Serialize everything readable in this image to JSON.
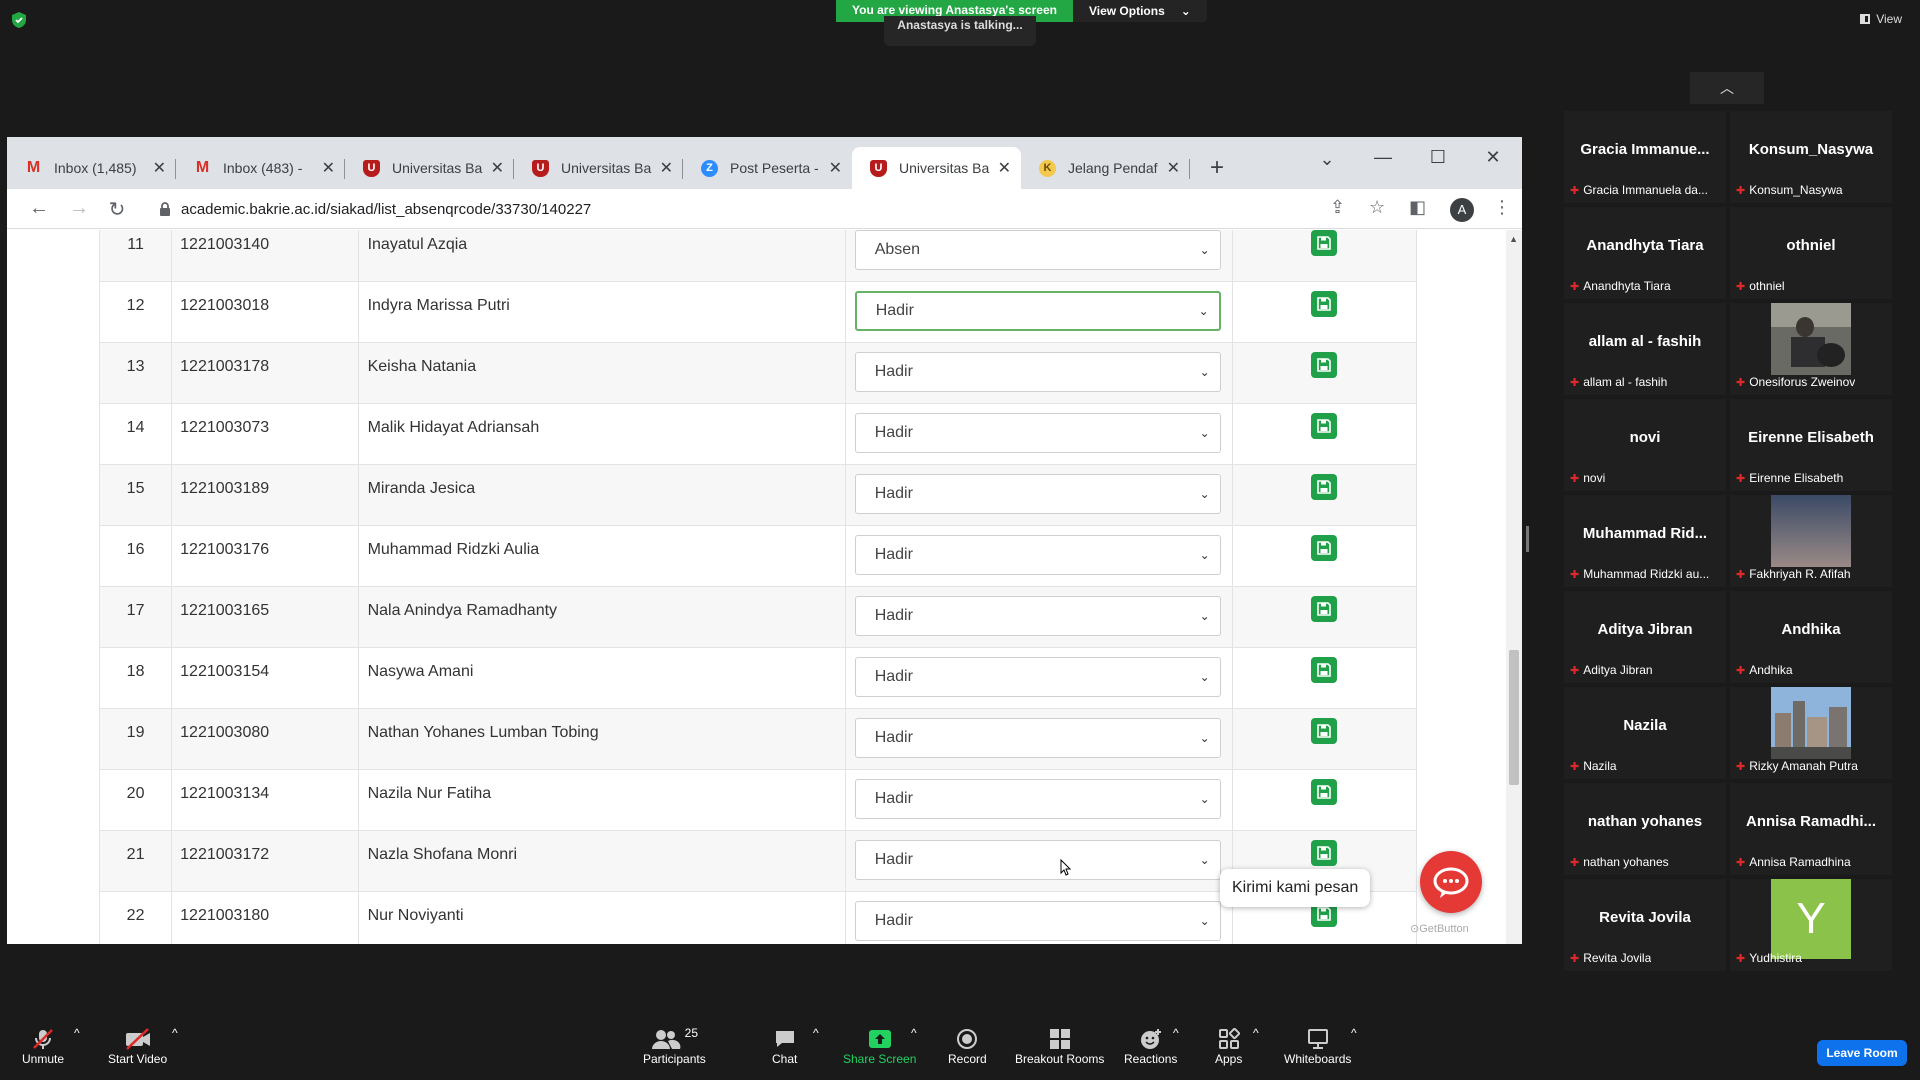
{
  "zoom": {
    "share_banner": "You are viewing Anastasya's screen",
    "view_options": "View Options",
    "talking": "Anastasya is talking...",
    "view": "View"
  },
  "browser": {
    "tabs": [
      {
        "title": "Inbox (1,485)",
        "icon": "gmail-icon"
      },
      {
        "title": "Inbox (483) -",
        "icon": "gmail-icon"
      },
      {
        "title": "Universitas Ba",
        "icon": "university-icon"
      },
      {
        "title": "Universitas Ba",
        "icon": "university-icon"
      },
      {
        "title": "Post Peserta -",
        "icon": "zoom-icon"
      },
      {
        "title": "Universitas Ba",
        "icon": "university-icon"
      },
      {
        "title": "Jelang Pendaf",
        "icon": "k-icon"
      }
    ],
    "url": "academic.bakrie.ac.id/siakad/list_absenqrcode/33730/140227",
    "avatar_letter": "A"
  },
  "table": {
    "rows": [
      {
        "no": "11",
        "nim": "1221003140",
        "name": "Inayatul Azqia",
        "status": "Absen"
      },
      {
        "no": "12",
        "nim": "1221003018",
        "name": "Indyra Marissa Putri",
        "status": "Hadir"
      },
      {
        "no": "13",
        "nim": "1221003178",
        "name": "Keisha Natania",
        "status": "Hadir"
      },
      {
        "no": "14",
        "nim": "1221003073",
        "name": "Malik Hidayat Adriansah",
        "status": "Hadir"
      },
      {
        "no": "15",
        "nim": "1221003189",
        "name": "Miranda Jesica",
        "status": "Hadir"
      },
      {
        "no": "16",
        "nim": "1221003176",
        "name": "Muhammad Ridzki Aulia",
        "status": "Hadir"
      },
      {
        "no": "17",
        "nim": "1221003165",
        "name": "Nala Anindya Ramadhanty",
        "status": "Hadir"
      },
      {
        "no": "18",
        "nim": "1221003154",
        "name": "Nasywa Amani",
        "status": "Hadir"
      },
      {
        "no": "19",
        "nim": "1221003080",
        "name": "Nathan Yohanes Lumban Tobing",
        "status": "Hadir"
      },
      {
        "no": "20",
        "nim": "1221003134",
        "name": "Nazila Nur Fatiha",
        "status": "Hadir"
      },
      {
        "no": "21",
        "nim": "1221003172",
        "name": "Nazla Shofana Monri",
        "status": "Hadir"
      },
      {
        "no": "22",
        "nim": "1221003180",
        "name": "Nur Noviyanti",
        "status": "Hadir"
      }
    ]
  },
  "widget": {
    "message": "Kirimi kami pesan",
    "brand": "GetButton"
  },
  "participants": [
    {
      "display": "Gracia Immanue...",
      "label": "Gracia Immanuela da..."
    },
    {
      "display": "Konsum_Nasywa",
      "label": "Konsum_Nasywa"
    },
    {
      "display": "Anandhyta Tiara",
      "label": "Anandhyta Tiara"
    },
    {
      "display": "othniel",
      "label": "othniel"
    },
    {
      "display": "allam al - fashih",
      "label": "allam al - fashih"
    },
    {
      "display": "",
      "label": "Onesiforus Zweinov"
    },
    {
      "display": "novi",
      "label": "novi"
    },
    {
      "display": "Eirenne Elisabeth",
      "label": "Eirenne Elisabeth"
    },
    {
      "display": "Muhammad Rid...",
      "label": "Muhammad Ridzki au..."
    },
    {
      "display": "",
      "label": "Fakhriyah R. Afifah"
    },
    {
      "display": "Aditya Jibran",
      "label": "Aditya Jibran"
    },
    {
      "display": "Andhika",
      "label": "Andhika"
    },
    {
      "display": "Nazila",
      "label": "Nazila"
    },
    {
      "display": "",
      "label": "Rizky Amanah Putra"
    },
    {
      "display": "nathan yohanes",
      "label": "nathan yohanes"
    },
    {
      "display": "Annisa Ramadhi...",
      "label": "Annisa Ramadhina"
    },
    {
      "display": "Revita Jovila",
      "label": "Revita Jovila"
    },
    {
      "display": "Y",
      "label": "Yudhistira"
    }
  ],
  "controls": {
    "unmute": "Unmute",
    "start_video": "Start Video",
    "participants": "Participants",
    "participants_count": "25",
    "chat": "Chat",
    "share_screen": "Share Screen",
    "record": "Record",
    "breakout_rooms": "Breakout Rooms",
    "reactions": "Reactions",
    "apps": "Apps",
    "whiteboards": "Whiteboards",
    "leave_room": "Leave Room"
  }
}
